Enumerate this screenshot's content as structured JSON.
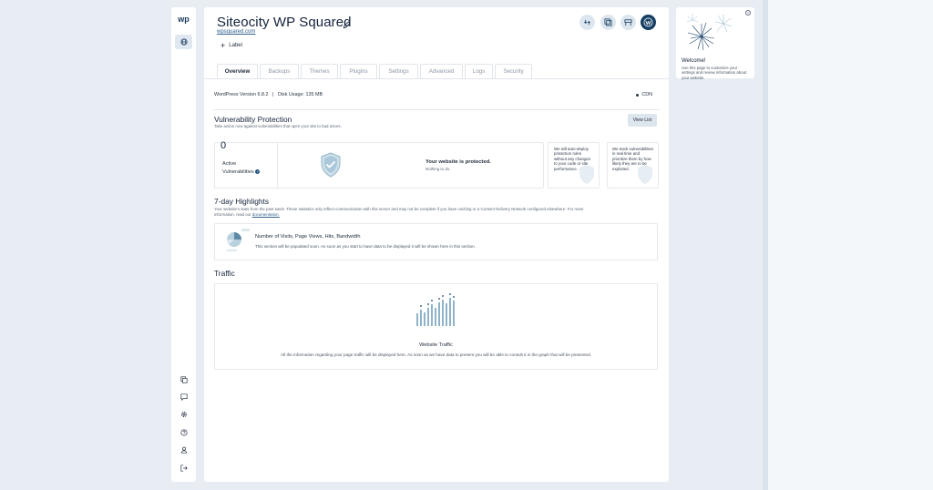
{
  "sidebar": {
    "logo": "wp",
    "globe_icon": "globe-icon",
    "bottom_icons": [
      "copy-icon",
      "chat-icon",
      "gear-icon",
      "help-icon",
      "user-icon",
      "logout-icon"
    ]
  },
  "header": {
    "title": "Siteocity WP Squared",
    "domain": "wpsquared.com",
    "label_button": "Label",
    "action_icons": [
      "refresh-icon",
      "clone-icon",
      "staging-icon",
      "wordpress-icon"
    ]
  },
  "tabs": [
    "Overview",
    "Backups",
    "Themes",
    "Plugins",
    "Settings",
    "Advanced",
    "Logs",
    "Security"
  ],
  "active_tab": "Overview",
  "status_bar": {
    "wp_version": "WordPress Version 6.8.2",
    "separator": "|",
    "disk_usage": "Disk Usage: 135 MB",
    "cdn": "CDN"
  },
  "vulnerability": {
    "title": "Vulnerability Protection",
    "subtitle": "Take action now against vulnerabilities that open your site to bad actors.",
    "view_list": "View List",
    "count": "0",
    "count_label_1": "Active",
    "count_label_2": "Vulnerabilities",
    "help": "?",
    "status_title": "Your website is protected.",
    "status_sub": "Nothing to do.",
    "card1": "We will auto-deploy protection rules without any changes to your code or site performance.",
    "card2": "We track vulnerabilities in real time and prioritize them by how likely they are to be exploited."
  },
  "highlights": {
    "title": "7-day Highlights",
    "subtitle_1": "Your website's stats from the past week. These statistics only reflect communication with this server and may not be complete if you have caching or a Content Delivery Network configured elsewhere. For more",
    "subtitle_2": "information, read our",
    "subtitle_link": "documentation.",
    "box_title": "Number of Visits, Page Views, Hits, Bandwidth",
    "box_text": "This section will be populated soon. As soon as you start to have data to be displayed it will be shown here in this section."
  },
  "traffic": {
    "title": "Traffic",
    "box_title": "Website Traffic",
    "box_text": "All the information regarding your page traffic will be displayed here. As soon as we have data to present you will be able to consult it in the graph that will be presented."
  },
  "welcome": {
    "title": "Welcome!",
    "text": "Use this page to customize your settings and review information about your website.",
    "close": "×"
  },
  "colors": {
    "accent": "#163e63",
    "accent_light": "#dde6ef",
    "illustration": "#8fb4c9"
  }
}
